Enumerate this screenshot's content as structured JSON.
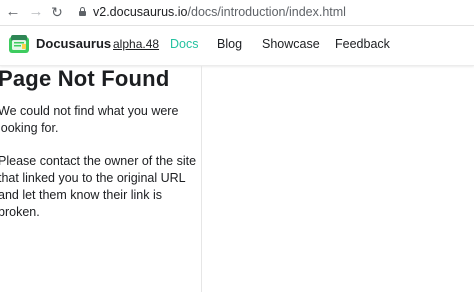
{
  "browser": {
    "url_host": "v2.docusaurus.io",
    "url_path": "/docs/introduction/index.html"
  },
  "navbar": {
    "brand": "Docusaurus",
    "version": "alpha.48",
    "links": [
      "Docs",
      "Blog",
      "Showcase",
      "Feedback"
    ],
    "active_link": "Docs",
    "accent_color": "#25c2a0"
  },
  "content": {
    "title": "Page Not Found",
    "paragraph_1": "We could not find what you were looking for.",
    "paragraph_2": "Please contact the owner of the site that linked you to the original URL and let them know their link is broken."
  }
}
